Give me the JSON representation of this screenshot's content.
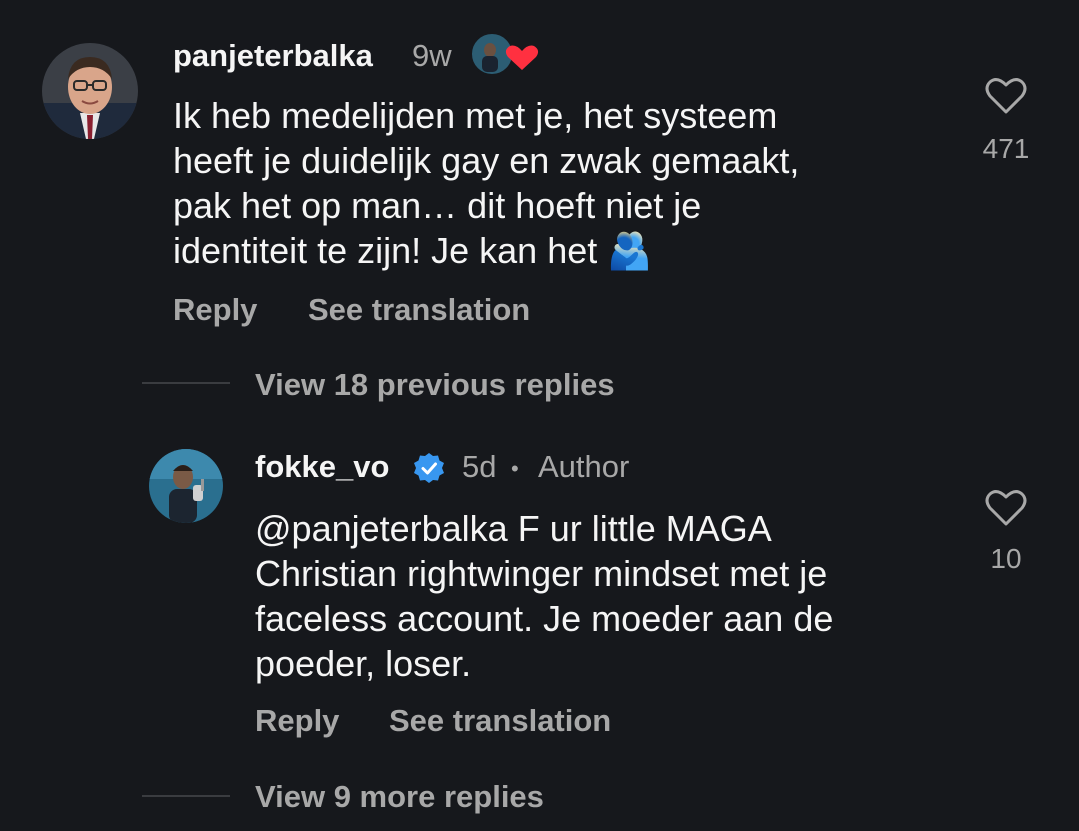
{
  "comment": {
    "username": "panjeterbalka",
    "time": "9w",
    "text_lines": [
      "Ik heb medelijden met je, het systeem",
      "heeft je duidelijk gay en zwak gemaakt,",
      "pak het op man… dit hoeft niet je",
      "identiteit te zijn! Je kan het 🫂"
    ],
    "likes": "471",
    "reply_label": "Reply",
    "translate_label": "See translation"
  },
  "view_previous_label": "View 18 previous replies",
  "reply": {
    "username": "fokke_vo",
    "time": "5d",
    "separator": "•",
    "author_label": "Author",
    "text_lines": [
      "@panjeterbalka F ur little MAGA",
      "Christian rightwinger mindset met je",
      "faceless account. Je moeder aan de",
      "poeder, loser."
    ],
    "likes": "10",
    "reply_label": "Reply",
    "translate_label": "See translation"
  },
  "view_more_label": "View 9 more replies",
  "colors": {
    "background": "#16181c",
    "primary_text": "#f5f5f5",
    "secondary_text": "#a8a8a8",
    "verified": "#3897f0",
    "heart_red": "#ff3040"
  }
}
